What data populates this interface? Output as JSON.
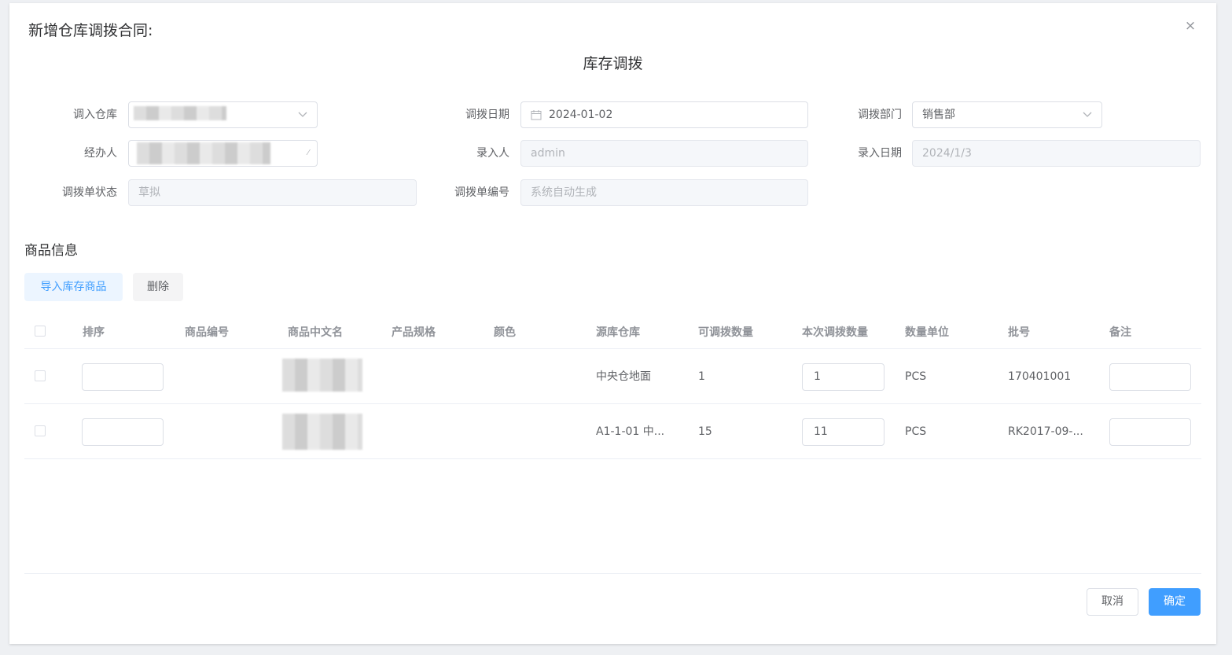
{
  "dialog": {
    "title": "新增仓库调拨合同:",
    "close_icon": "×",
    "subtitle": "库存调拨"
  },
  "form": {
    "in_warehouse_label": "调入仓库",
    "transfer_date_label": "调拨日期",
    "transfer_date_value": "2024-01-02",
    "department_label": "调拨部门",
    "department_value": "销售部",
    "handler_label": "经办人",
    "entered_by_label": "录入人",
    "entered_by_value": "admin",
    "entry_date_label": "录入日期",
    "entry_date_value": "2024/1/3",
    "status_label": "调拨单状态",
    "status_value": "草拟",
    "order_no_label": "调拨单编号",
    "order_no_value": "系统自动生成"
  },
  "goods": {
    "section_title": "商品信息",
    "import_button": "导入库存商品",
    "delete_button": "删除",
    "columns": [
      "排序",
      "商品编号",
      "商品中文名",
      "产品规格",
      "颜色",
      "源库仓库",
      "可调拨数量",
      "本次调拨数量",
      "数量单位",
      "批号",
      "备注"
    ],
    "rows": [
      {
        "sort": "",
        "code": "",
        "spec": "",
        "color": "",
        "source_warehouse": "中央仓地面",
        "available_qty": "1",
        "transfer_qty": "1",
        "unit": "PCS",
        "batch": "170401001",
        "remark": ""
      },
      {
        "sort": "",
        "code": "",
        "spec": "",
        "color": "",
        "source_warehouse": "A1-1-01 中...",
        "available_qty": "15",
        "transfer_qty": "11",
        "unit": "PCS",
        "batch": "RK2017-09-...",
        "remark": ""
      }
    ]
  },
  "footer": {
    "cancel_button": "取消",
    "ok_button": "确定"
  },
  "colors": {
    "primary": "#409eff",
    "primary_light": "#ecf5ff",
    "border": "#dcdfe6"
  }
}
